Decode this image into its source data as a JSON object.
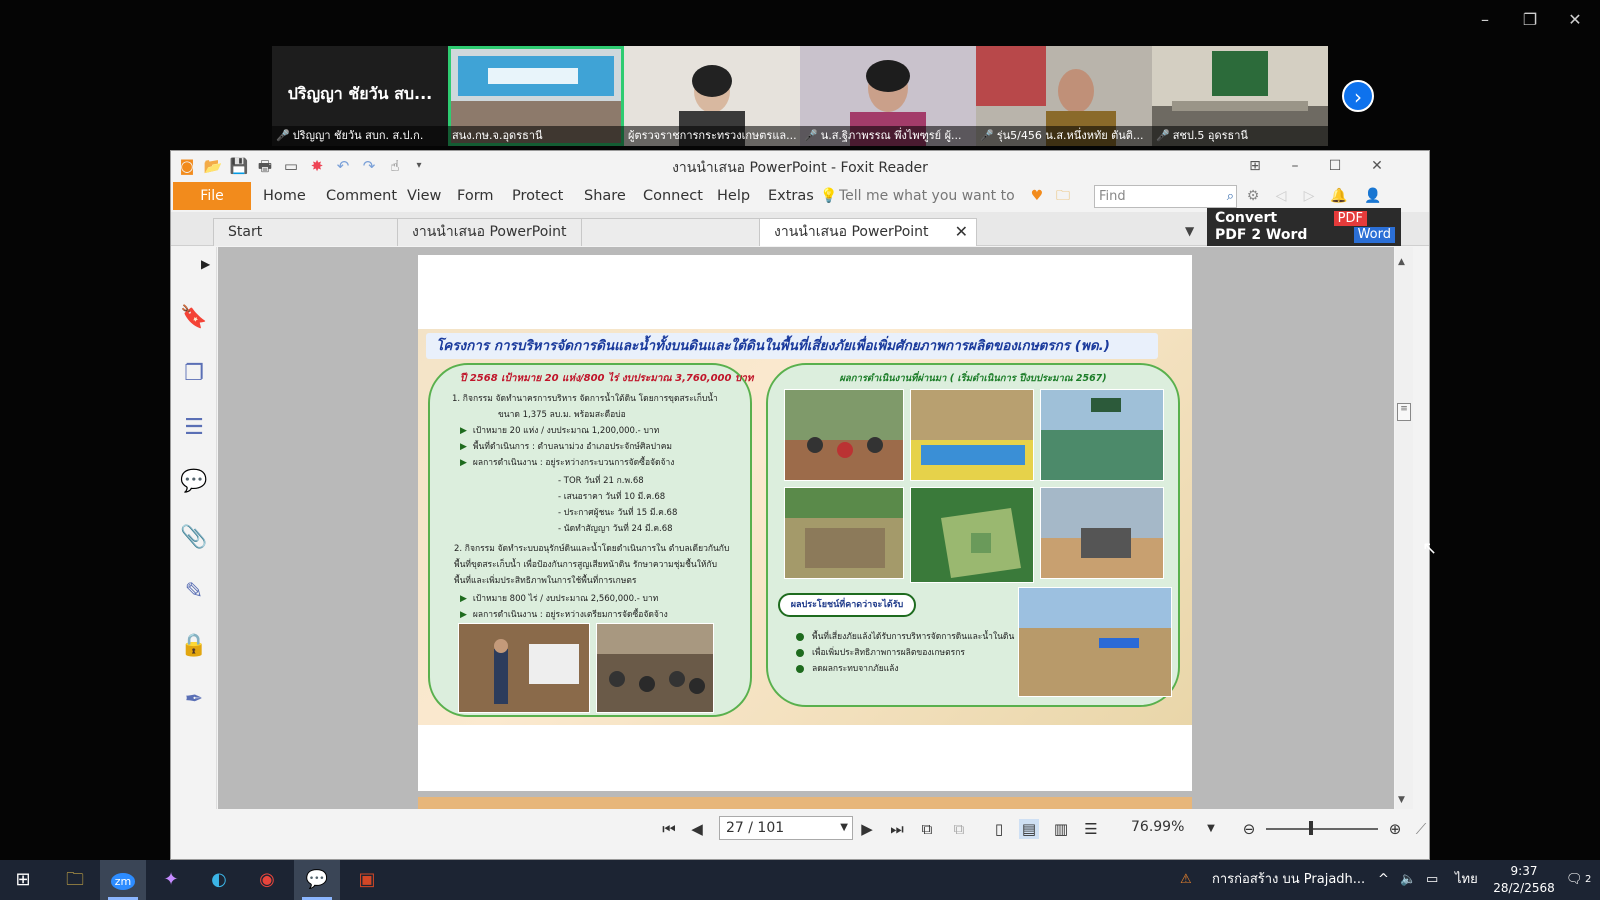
{
  "zoom_window": {
    "controls": [
      "–",
      "❐",
      "✕"
    ]
  },
  "participants": [
    {
      "name": "ปริญญา ชัยวัน สบก. ส.ป.ก.",
      "display_big": "ปริญญา ชัยวัน สบ...",
      "video": false,
      "muted": true
    },
    {
      "name": "สนง.กษ.จ.อุดรธานี",
      "video": true,
      "muted": false,
      "active": true
    },
    {
      "name": "ผู้ตรวจราชการกระทรวงเกษตรแล...",
      "video": true,
      "muted": false
    },
    {
      "name": "น.ส.ฐิภาพรรณ พึ่งไพฑูรย์ ผู้...",
      "video": true,
      "muted": true
    },
    {
      "name": "รุ่น5/456 น.ส.หนึ่งหทัย ตันติ...",
      "video": true,
      "muted": true
    },
    {
      "name": "สชป.5 อุดรธานี",
      "video": true,
      "muted": true
    }
  ],
  "foxit": {
    "window_title": "งานนำเสนอ PowerPoint - Foxit Reader",
    "menu": {
      "file": "File",
      "items": [
        "Home",
        "Comment",
        "View",
        "Form",
        "Protect",
        "Share",
        "Connect",
        "Help",
        "Extras"
      ],
      "tell_me": "Tell me what you want to",
      "find_placeholder": "Find"
    },
    "tabs": [
      {
        "label": "Start",
        "active": false
      },
      {
        "label": "งานนำเสนอ PowerPoint",
        "active": false
      },
      {
        "label": "",
        "active": false
      },
      {
        "label": "งานนำเสนอ PowerPoint",
        "active": true
      }
    ],
    "convert_ad": {
      "line1": "Convert",
      "line2": "PDF 2 Word",
      "pdf_badge": "PDF",
      "word_badge": "Word"
    },
    "status": {
      "page_value": "27 / 101",
      "zoom": "76.99%",
      "zoom_fraction": 0.4
    }
  },
  "slide": {
    "title": "โครงการ การบริหารจัดการดินและน้ำทั้งบนดินและใต้ดินในพื้นที่เสี่ยงภัยเพื่อเพิ่มศักยภาพการผลิตของเกษตรกร (พด.)",
    "left": {
      "heading": "ปี 2568 เป้าหมาย 20 แห่ง/800 ไร่ งบประมาณ 3,760,000 บาท",
      "act1_title": "1. กิจกรรม",
      "act1_text": "จัดทำนาครการบริหาร จัดการน้ำใต้ดิน โดยการขุดสระเก็บน้ำ",
      "act1_sub": "ขนาด 1,375 ลบ.ม. พร้อมสะดือบ่อ",
      "act1_bullets": [
        "เป้าหมาย 20 แห่ง / งบประมาณ 1,200,000.- บาท",
        "พื้นที่ดำเนินการ : ตำบลนาม่วง อำเภอประจักษ์ศิลปาคม",
        "ผลการดำเนินงาน : อยู่ระหว่างกระบวนการจัดซื้อจัดจ้าง"
      ],
      "act1_dates": [
        "- TOR  วันที่ 21 ก.พ.68",
        "- เสนอราคา  วันที่ 10 มี.ค.68",
        "- ประกาศผู้ชนะ  วันที่ 15 มี.ค.68",
        "- นัดทำสัญญา วันที่  24 มี.ค.68"
      ],
      "act2_title": "2. กิจกรรม",
      "act2_lines": [
        "จัดทำระบบอนุรักษ์ดินและน้ำโดยดำเนินการใน ตำบลเดียวกันกับ",
        "พื้นที่ขุดสระเก็บน้ำ    เพื่อป้องกันการสูญเสียหน้าดิน   รักษาความชุ่มชื้นให้กับ",
        "พื้นที่และเพิ่มประสิทธิภาพในการใช้พื้นที่การเกษตร"
      ],
      "act2_bullets": [
        "เป้าหมาย 800 ไร่ / งบประมาณ 2,560,000.- บาท",
        "ผลการดำเนินงาน : อยู่ระหว่างเตรียมการจัดซื้อจัดจ้าง"
      ]
    },
    "right": {
      "heading": "ผลการดำเนินงานที่ผ่านมา ( เริ่มดำเนินการ ปีงบประมาณ 2567)",
      "benefit_label": "ผลประโยชน์ที่คาดว่าจะได้รับ",
      "benefits": [
        "พื้นที่เสี่ยงภัยแล้งได้รับการบริหารจัดการดินและน้ำในดิน",
        "เพื่อเพิ่มประสิทธิภาพการผลิตของเกษตรกร",
        "ลดผลกระทบจากภัยแล้ง"
      ]
    }
  },
  "taskbar": {
    "notification": "การก่อสร้าง บน Prajadh...",
    "lang": "ไทย",
    "time": "9:37",
    "date": "28/2/2568",
    "badge": "2"
  }
}
